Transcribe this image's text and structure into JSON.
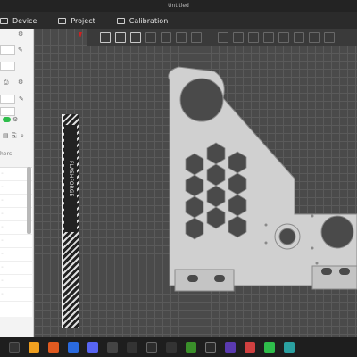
{
  "window": {
    "title": "Untitled"
  },
  "menubar": {
    "items": [
      {
        "label": "Device",
        "icon": "device-icon"
      },
      {
        "label": "Project",
        "icon": "project-icon"
      },
      {
        "label": "Calibration",
        "icon": "calibration-icon"
      }
    ]
  },
  "left_panel": {
    "section_hint": "hers"
  },
  "printer_label": "FLASHFORGE",
  "colors": {
    "accent_green": "#2ebd4b",
    "part_fill": "#d0d0d0",
    "grid_bg": "#4a4a4a",
    "part_cutout": "#4a4a4a"
  },
  "taskbar_icons": [
    "firefox-icon",
    "steam-icon",
    "discord-icon",
    "spotify-icon",
    "app-icon",
    "epic-icon",
    "explorer-icon",
    "minecraft-icon",
    "xbox-icon",
    "steam2-icon",
    "game-icon",
    "slicer-icon",
    "green-app-icon"
  ]
}
